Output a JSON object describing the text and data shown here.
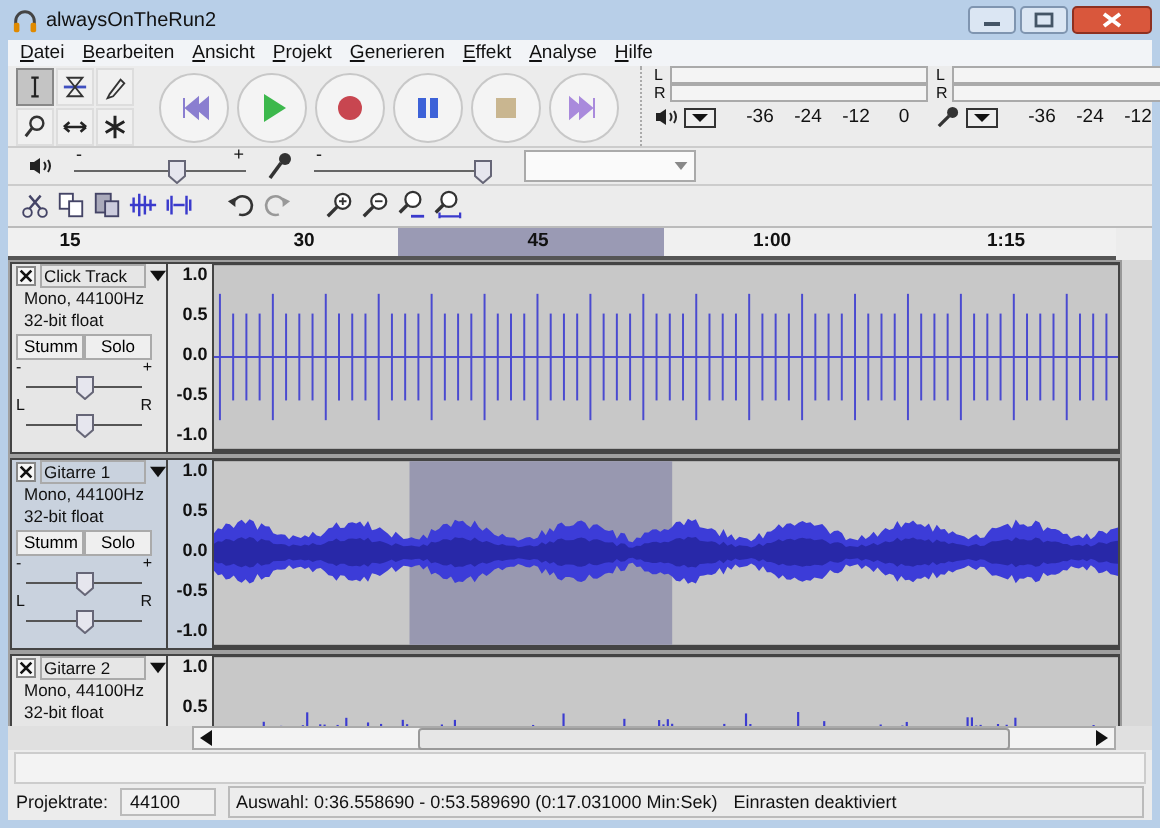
{
  "window": {
    "title": "alwaysOnTheRun2"
  },
  "menu": [
    {
      "label": "Datei"
    },
    {
      "label": "Bearbeiten"
    },
    {
      "label": "Ansicht"
    },
    {
      "label": "Projekt"
    },
    {
      "label": "Generieren"
    },
    {
      "label": "Effekt"
    },
    {
      "label": "Analyse"
    },
    {
      "label": "Hilfe"
    }
  ],
  "tools": [
    {
      "kind": "select",
      "selected": true
    },
    {
      "kind": "envelope",
      "selected": false
    },
    {
      "kind": "draw",
      "selected": false
    },
    {
      "kind": "zoom",
      "selected": false
    },
    {
      "kind": "timeshift",
      "selected": false
    },
    {
      "kind": "multi",
      "selected": false
    }
  ],
  "meters": [
    {
      "kind": "playback",
      "channels": [
        "L",
        "R"
      ],
      "scale": [
        "-36",
        "-24",
        "-12",
        "0"
      ]
    },
    {
      "kind": "recording",
      "channels": [
        "L",
        "R"
      ],
      "scale": [
        "-36",
        "-24",
        "-12"
      ]
    }
  ],
  "mixer": [
    {
      "kind": "playback",
      "minus": "-",
      "plus": "+",
      "level": 0.6
    },
    {
      "kind": "recording",
      "minus": "-",
      "level": 0.98
    }
  ],
  "ruler": {
    "ticks": [
      "15",
      "30",
      "45",
      "1:00",
      "1:15"
    ]
  },
  "tracks": [
    {
      "name": "Click Track",
      "info": [
        "Mono, 44100Hz",
        "32-bit float"
      ],
      "buttons": [
        "Stumm",
        "Solo"
      ],
      "gain": {
        "minus": "-",
        "plus": "+",
        "level": 0.5
      },
      "pan": {
        "left": "L",
        "right": "R",
        "level": 0.5
      },
      "scale": [
        "1.0",
        "0.5",
        "0.0",
        "-0.5",
        "-1.0"
      ],
      "selected": false,
      "kind": "click"
    },
    {
      "name": "Gitarre 1",
      "info": [
        "Mono, 44100Hz",
        "32-bit float"
      ],
      "buttons": [
        "Stumm",
        "Solo"
      ],
      "gain": {
        "minus": "-",
        "plus": "+",
        "level": 0.5
      },
      "pan": {
        "left": "L",
        "right": "R",
        "level": 0.5
      },
      "scale": [
        "1.0",
        "0.5",
        "0.0",
        "-0.5",
        "-1.0"
      ],
      "selected": true,
      "kind": "noise"
    },
    {
      "name": "Gitarre 2",
      "info": [
        "Mono, 44100Hz",
        "32-bit float"
      ],
      "scale": [
        "1.0",
        "0.5"
      ],
      "selected": false,
      "kind": "spiky"
    }
  ],
  "status": {
    "rate_label": "Projektrate:",
    "rate": "44100",
    "selection": "Auswahl: 0:36.558690 - 0:53.589690 (0:17.031000 Min:Sek)",
    "snap": "Einrasten deaktiviert"
  }
}
